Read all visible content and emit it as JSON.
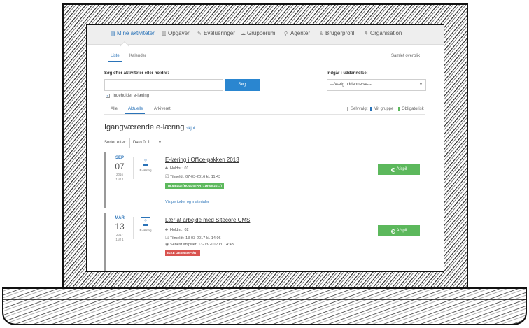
{
  "nav": {
    "items": [
      {
        "label": "Mine aktiviteter",
        "icon": "activities-icon",
        "glyph": "▤"
      },
      {
        "label": "Opgaver",
        "icon": "tasks-icon",
        "glyph": "▥"
      },
      {
        "label": "Evalueringer",
        "icon": "evaluations-icon",
        "glyph": "✎"
      },
      {
        "label": "Grupperum",
        "icon": "group-room-icon",
        "glyph": "☁"
      },
      {
        "label": "Agenter",
        "icon": "agents-icon",
        "glyph": "⚲"
      },
      {
        "label": "Brugerprofil",
        "icon": "user-profile-icon",
        "glyph": "♙"
      },
      {
        "label": "Organisation",
        "icon": "organisation-icon",
        "glyph": "⚘"
      }
    ]
  },
  "subtabs": {
    "list": "Liste",
    "calendar": "Kalender",
    "overview": "Samlet overblik"
  },
  "search": {
    "label": "Søg efter aktiviteter eller holdnr:",
    "value": "",
    "button": "Søg",
    "education_label": "Indgår i uddannelse:",
    "education_value": "---Vælg uddannelse---",
    "elearning_label": "Indeholder e-læring"
  },
  "filters": {
    "all": "Alle",
    "current": "Aktuelle",
    "archived": "Arkiveret"
  },
  "legend": {
    "optional": "Selvvalgt",
    "mine": "Mit gruppe",
    "mandatory": "Obligatorisk"
  },
  "section": {
    "title": "Igangværende e-læring",
    "hide": "skjul"
  },
  "sort": {
    "label": "Sorter efter:",
    "value": "Dato 0..1"
  },
  "cards": [
    {
      "month": "SEP",
      "day": "07",
      "year": "2016",
      "count": "1 af 1",
      "type": "E-læring",
      "title": "E-læring i Office-pakken 2013",
      "team": "Holdnr.: 01",
      "period": "Tilmeldt: 07-03-2016 kl. 11:43",
      "badge": "TILMELDT(HOLDSTART: 16-06-2017)",
      "link": "Vis perioder og materialer",
      "button": "Afspil"
    },
    {
      "month": "MAR",
      "day": "13",
      "year": "2017",
      "count": "1 af 1",
      "type": "E-læring",
      "title": "Lær at arbejde med Sitecore CMS",
      "team": "Holdnr.: 02",
      "period": "Tilmeldt: 13-03-2017 kl. 14:06",
      "last_played": "Senest afspillet: 13-03-2017 kl. 14:43",
      "badge": "IKKE GENNEMFØRT",
      "button": "Afspil"
    }
  ],
  "colors": {
    "accent": "#2a73b8",
    "success": "#5cb85c",
    "danger": "#d9534f",
    "button": "#2a86d0"
  }
}
